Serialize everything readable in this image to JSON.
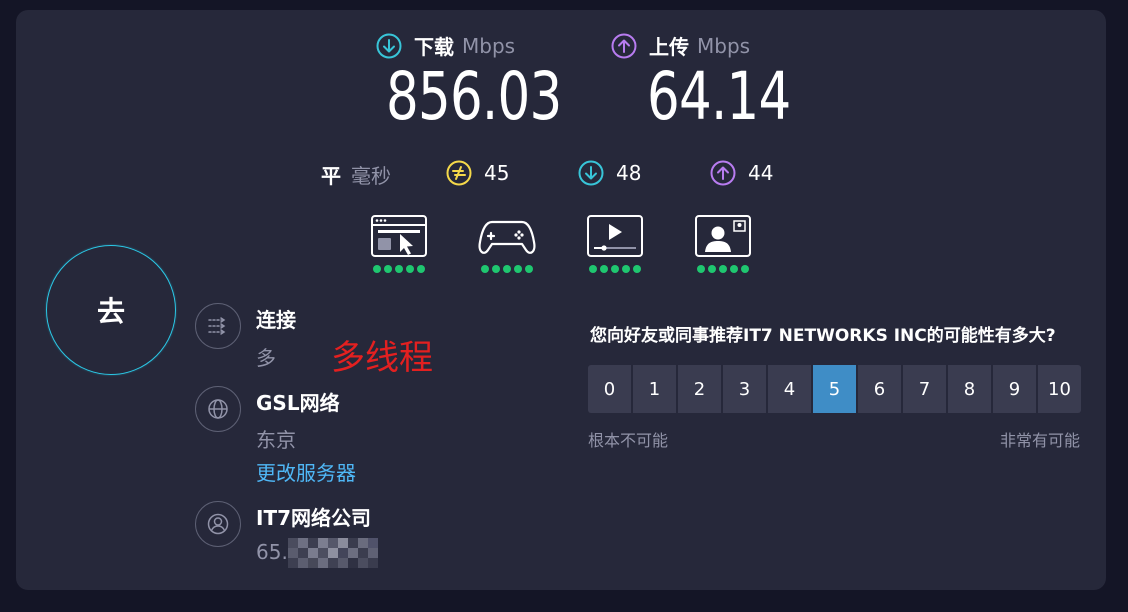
{
  "speed": {
    "download": {
      "label": "下载",
      "unit": "Mbps",
      "value": "856.03",
      "icon": "download-arrow-icon",
      "color": "#38c5d8"
    },
    "upload": {
      "label": "上传",
      "unit": "Mbps",
      "value": "64.14",
      "icon": "upload-arrow-icon",
      "color": "#b87cf0"
    }
  },
  "ping": {
    "label": "平",
    "unit": "毫秒",
    "idle": "45",
    "download": "48",
    "upload": "44",
    "idle_icon": "ping-lightning-icon",
    "idle_color": "#f5d94a"
  },
  "activities": [
    {
      "icon": "web-browsing-icon",
      "rating": 5
    },
    {
      "icon": "gaming-controller-icon",
      "rating": 5
    },
    {
      "icon": "video-streaming-icon",
      "rating": 5
    },
    {
      "icon": "video-call-icon",
      "rating": 5
    }
  ],
  "go_button": {
    "label": "去"
  },
  "connection": {
    "title": "连接",
    "mode": "多",
    "annotation": "多线程",
    "icon": "connections-icon"
  },
  "server": {
    "title": "GSL网络",
    "location": "东京",
    "change_link": "更改服务器",
    "icon": "globe-icon"
  },
  "provider": {
    "title": "IT7网络公司",
    "ip_prefix": "65.4",
    "icon": "user-icon"
  },
  "survey": {
    "question": "您向好友或同事推荐IT7 NETWORKS INC的可能性有多大?",
    "options": [
      "0",
      "1",
      "2",
      "3",
      "4",
      "5",
      "6",
      "7",
      "8",
      "9",
      "10"
    ],
    "selected": "5",
    "low_label": "根本不可能",
    "high_label": "非常有可能"
  },
  "colors": {
    "background": "#141526",
    "card": "#26283a",
    "accent": "#3f8dc6",
    "good": "#1fc770"
  }
}
